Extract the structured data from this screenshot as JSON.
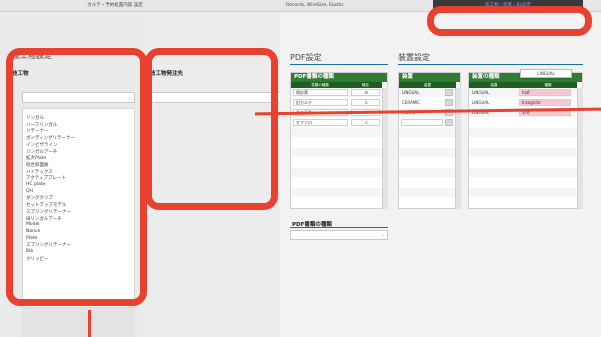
{
  "tabs": [
    {
      "label": "カルテ・予約処置内容 設定"
    },
    {
      "label": "Records, WireSize, Elastic"
    },
    {
      "label": "技工物・装置・Bs設定"
    }
  ],
  "left": {
    "title": "技工物設定",
    "list_title": "技工物",
    "items": [
      "リンガル",
      "ハーフリンガル",
      "リテーナー",
      "ボンディングリテーナー",
      "インビザライン",
      "リンガルアーチ",
      "拡大Plate",
      "咬合斜面板",
      "ハイテックス",
      "アクティブプレート",
      "HC plate",
      "QH",
      "ダングクリプ",
      "セットアップモデル",
      "スプリングリテーナー",
      "IBリンガルアーチ",
      "Model",
      "Nance",
      "Plate",
      "スプリングリテーナー",
      "Bib",
      "クリッピー"
    ]
  },
  "middle": {
    "list_title": "技工物発注先"
  },
  "pdf": {
    "title": "PDF設定",
    "panel_title": "PDF書類の種類",
    "col1": "書類の種類",
    "col2": "略名",
    "rows": [
      {
        "name": "問診票",
        "abbr": "m"
      },
      {
        "name": "旧カルテ",
        "abbr": "k"
      },
      {
        "name": "歯の画像",
        "abbr": "I"
      },
      {
        "name": "セファロ",
        "abbr": "c"
      }
    ],
    "panel2_title": "PDF書類の種類"
  },
  "device": {
    "title": "装置設定",
    "panel_title": "装置",
    "col": "装置",
    "rows": [
      "LINGUAL",
      "CERAMIC",
      "METAL"
    ],
    "panel2_title": "装置の種類",
    "col_a": "装置",
    "col_b": "種類",
    "rows2": [
      {
        "device": "LINGUAL",
        "kind": "half"
      },
      {
        "device": "LINGUAL",
        "kind": "Incognito"
      },
      {
        "device": "LINGUAL",
        "kind": "STb"
      }
    ],
    "tooltip": "LINGUAL"
  },
  "colors": {
    "accent_red": "#e8412f",
    "header_green": "#2f7d32",
    "pink": "#f6c9d2",
    "active_tab_text": "#6fa0ff"
  }
}
